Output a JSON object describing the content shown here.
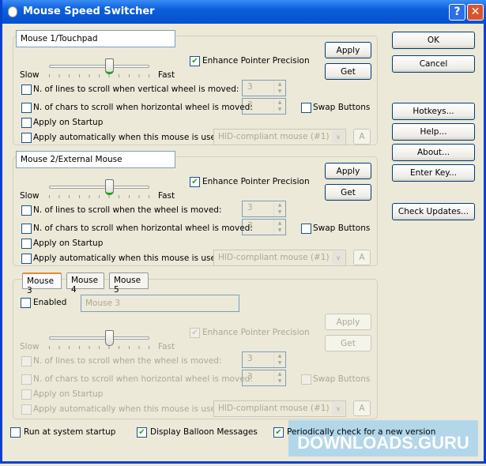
{
  "window": {
    "title": "Mouse Speed Switcher",
    "help_btn": "?",
    "close_btn": "✕"
  },
  "common": {
    "slow": "Slow",
    "fast": "Fast",
    "enhance": "Enhance Pointer Precision",
    "apply": "Apply",
    "get": "Get",
    "chars_label": "N. of chars to scroll when  horizontal wheel is moved:",
    "swap": "Swap Buttons",
    "startup": "Apply on Startup",
    "auto": "Apply automatically when this mouse is used:",
    "device": "HID-compliant mouse (#1)",
    "a_btn": "A",
    "spin_value": "3"
  },
  "mouse1": {
    "name": "Mouse 1/Touchpad",
    "lines_label": "N. of lines to scroll when vertical wheel is moved:",
    "speed": 6,
    "enhance_checked": true
  },
  "mouse2": {
    "name": "Mouse 2/External Mouse",
    "lines_label": "N. of lines to scroll when the wheel is moved:",
    "speed": 6,
    "enhance_checked": true
  },
  "mouse3": {
    "tabs": [
      "Mouse 3",
      "Mouse 4",
      "Mouse 5"
    ],
    "enabled_label": "Enabled",
    "name": "Mouse 3",
    "lines_label": "N. of lines to scroll when the wheel is moved:",
    "speed": 6,
    "enhance_checked": true
  },
  "side": {
    "ok": "OK",
    "cancel": "Cancel",
    "hotkeys": "Hotkeys...",
    "help": "Help...",
    "about": "About...",
    "enter_key": "Enter Key...",
    "check_updates": "Check Updates..."
  },
  "bottom": {
    "run_startup": "Run at system startup",
    "balloon": "Display Balloon Messages",
    "periodic": "Periodically check for a new version"
  },
  "watermark": "DOWNLOADS.GURU"
}
